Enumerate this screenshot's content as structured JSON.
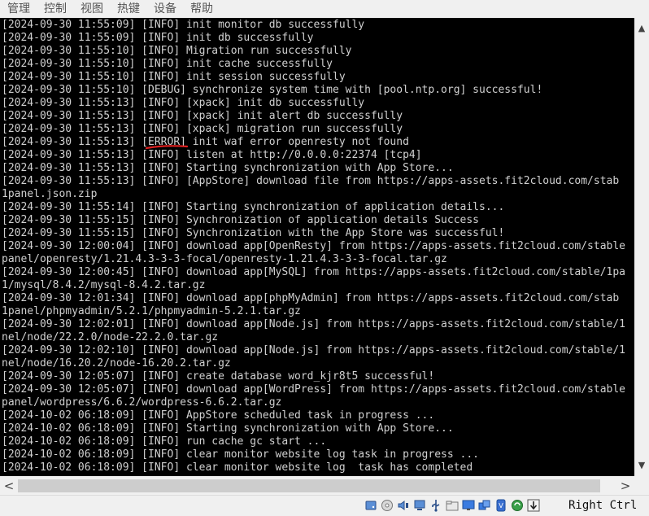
{
  "menu": [
    "管理",
    "控制",
    "视图",
    "热键",
    "设备",
    "帮助"
  ],
  "console": {
    "lines": [
      "[2024-09-30 11:55:09] [INFO] init monitor db successfully",
      "[2024-09-30 11:55:09] [INFO] init db successfully",
      "[2024-09-30 11:55:10] [INFO] Migration run successfully",
      "[2024-09-30 11:55:10] [INFO] init cache successfully",
      "[2024-09-30 11:55:10] [INFO] init session successfully",
      "[2024-09-30 11:55:10] [DEBUG] synchronize system time with [pool.ntp.org] successful!",
      "[2024-09-30 11:55:13] [INFO] [xpack] init db successfully",
      "[2024-09-30 11:55:13] [INFO] [xpack] init alert db successfully",
      "[2024-09-30 11:55:13] [INFO] [xpack] migration run successfully",
      "[2024-09-30 11:55:13] [ERROR] init waf error openresty not found",
      "[2024-09-30 11:55:13] [INFO] listen at http://0.0.0.0:22374 [tcp4]",
      "[2024-09-30 11:55:13] [INFO] Starting synchronization with App Store...",
      "[2024-09-30 11:55:13] [INFO] [AppStore] download file from https://apps-assets.fit2cloud.com/stab",
      "1panel.json.zip",
      "[2024-09-30 11:55:14] [INFO] Starting synchronization of application details...",
      "[2024-09-30 11:55:15] [INFO] Synchronization of application details Success",
      "[2024-09-30 11:55:15] [INFO] Synchronization with the App Store was successful!",
      "[2024-09-30 12:00:04] [INFO] download app[OpenResty] from https://apps-assets.fit2cloud.com/stable",
      "panel/openresty/1.21.4.3-3-3-focal/openresty-1.21.4.3-3-3-focal.tar.gz",
      "[2024-09-30 12:00:45] [INFO] download app[MySQL] from https://apps-assets.fit2cloud.com/stable/1pa",
      "1/mysql/8.4.2/mysql-8.4.2.tar.gz",
      "[2024-09-30 12:01:34] [INFO] download app[phpMyAdmin] from https://apps-assets.fit2cloud.com/stab",
      "1panel/phpmyadmin/5.2.1/phpmyadmin-5.2.1.tar.gz",
      "[2024-09-30 12:02:01] [INFO] download app[Node.js] from https://apps-assets.fit2cloud.com/stable/1",
      "nel/node/22.2.0/node-22.2.0.tar.gz",
      "[2024-09-30 12:02:10] [INFO] download app[Node.js] from https://apps-assets.fit2cloud.com/stable/1",
      "nel/node/16.20.2/node-16.20.2.tar.gz",
      "[2024-09-30 12:05:07] [INFO] create database word_kjr8t5 successful!",
      "[2024-09-30 12:05:07] [INFO] download app[WordPress] from https://apps-assets.fit2cloud.com/stable",
      "panel/wordpress/6.6.2/wordpress-6.6.2.tar.gz",
      "[2024-10-02 06:18:09] [INFO] AppStore scheduled task in progress ...",
      "[2024-10-02 06:18:09] [INFO] Starting synchronization with App Store...",
      "[2024-10-02 06:18:09] [INFO] run cache gc start ...",
      "[2024-10-02 06:18:09] [INFO] clear monitor website log task in progress ...",
      "[2024-10-02 06:18:09] [INFO] clear monitor website log  task has completed"
    ]
  },
  "colors": {
    "terminal_bg": "#000000",
    "terminal_text": "#d0d0d0",
    "error_underline": "#e02020"
  },
  "scrollbars": {
    "up_arrow": "▲",
    "down_arrow": "▼",
    "left_arrow": "<",
    "right_arrow": ">"
  },
  "status": {
    "icons": [
      "hard-disk-icon",
      "optical-drive-icon",
      "audio-icon",
      "network-icon",
      "usb-icon",
      "shared-folders-icon",
      "display-icon",
      "video-capture-icon",
      "cpu-icon",
      "recording-icon",
      "arrow-down-icon"
    ],
    "host_key": "Right Ctrl"
  }
}
